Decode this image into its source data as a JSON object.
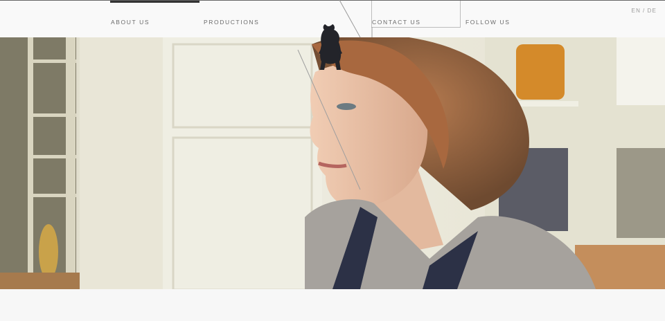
{
  "nav": {
    "items": [
      {
        "label": "ABOUT US"
      },
      {
        "label": "PRODUCTIONS"
      },
      {
        "label": "CONTACT US"
      },
      {
        "label": "FOLLOW US"
      }
    ],
    "active_index": 0
  },
  "lang": {
    "en": "EN",
    "separator": "/",
    "de": "DE"
  },
  "hero": {
    "image": "portrait-photo"
  },
  "mascot": {
    "icon": "bear-icon"
  },
  "colors": {
    "nav_text": "#6a6a6a",
    "active_bar": "#333333",
    "background": "#f6f6f6"
  }
}
